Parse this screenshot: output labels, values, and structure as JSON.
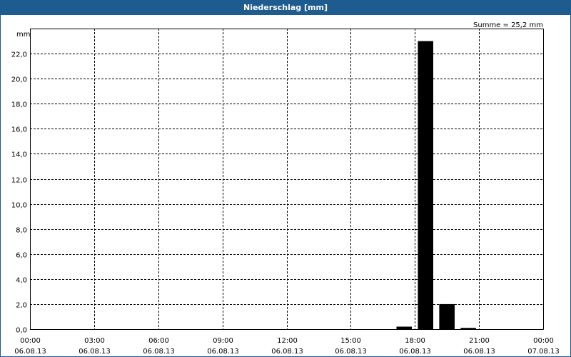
{
  "window": {
    "title": "Niederschlag [mm]"
  },
  "chart_data": {
    "type": "bar",
    "ylabel": "mm",
    "annotation": "Summe = 25,2 mm",
    "ylim": [
      0,
      24
    ],
    "xlim": [
      "06.08.13 00:00",
      "07.08.13 00:00"
    ],
    "grid": true,
    "yticks": [
      0,
      2,
      4,
      6,
      8,
      10,
      12,
      14,
      16,
      18,
      20,
      22
    ],
    "ytick_labels": [
      "0,0",
      "2,0",
      "4,0",
      "6,0",
      "8,0",
      "10,0",
      "12,0",
      "14,0",
      "16,0",
      "18,0",
      "20,0",
      "22,0"
    ],
    "xtick_labels": [
      {
        "time": "00:00",
        "date": "06.08.13"
      },
      {
        "time": "03:00",
        "date": "06.08.13"
      },
      {
        "time": "06:00",
        "date": "06.08.13"
      },
      {
        "time": "09:00",
        "date": "06.08.13"
      },
      {
        "time": "12:00",
        "date": "06.08.13"
      },
      {
        "time": "15:00",
        "date": "06.08.13"
      },
      {
        "time": "18:00",
        "date": "06.08.13"
      },
      {
        "time": "21:00",
        "date": "06.08.13"
      },
      {
        "time": "00:00",
        "date": "07.08.13"
      }
    ],
    "bars": [
      {
        "start": "06.08.13 17:00",
        "end": "06.08.13 18:00",
        "value": 0.2
      },
      {
        "start": "06.08.13 18:00",
        "end": "06.08.13 19:00",
        "value": 23.0
      },
      {
        "start": "06.08.13 19:00",
        "end": "06.08.13 20:00",
        "value": 2.0
      },
      {
        "start": "06.08.13 20:00",
        "end": "06.08.13 21:00",
        "value": 0.1
      }
    ],
    "bar_color": "#000000"
  }
}
